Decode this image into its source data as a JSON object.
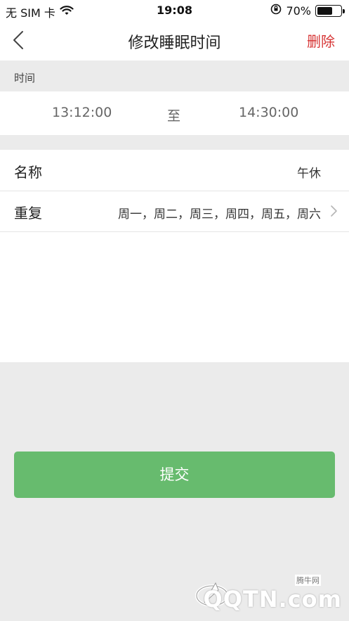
{
  "statusbar": {
    "carrier": "无 SIM 卡",
    "time": "19:08",
    "battery": "70%",
    "battery_level": 0.7
  },
  "navbar": {
    "title": "修改睡眠时间",
    "delete_label": "删除"
  },
  "time_section": {
    "label": "时间",
    "start": "13:12:00",
    "separator": "至",
    "end": "14:30:00"
  },
  "form": {
    "name_label": "名称",
    "name_value": "午休",
    "repeat_label": "重复",
    "repeat_value": "周一，周二，周三，周四，周五，周六"
  },
  "submit_label": "提交",
  "watermark": {
    "small": "腾牛网",
    "big": "QQTN.com"
  },
  "colors": {
    "submit_green": "#67bb6e",
    "delete_red": "#d63434",
    "background": "#ebebeb"
  }
}
